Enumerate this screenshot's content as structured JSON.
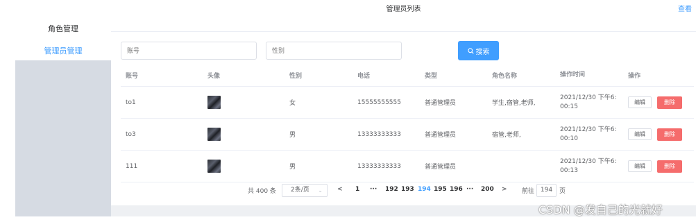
{
  "sidebar": {
    "items": [
      {
        "label": "角色管理"
      },
      {
        "label": "管理员管理"
      }
    ]
  },
  "header": {
    "title": "管理员列表",
    "view_link": "查看"
  },
  "search": {
    "account_placeholder": "账号",
    "gender_placeholder": "性别",
    "button_label": "搜索"
  },
  "table": {
    "columns": [
      "账号",
      "头像",
      "性别",
      "电话",
      "类型",
      "角色名称",
      "操作时间",
      "操作"
    ],
    "rows": [
      {
        "account": "to1",
        "gender": "女",
        "phone": "15555555555",
        "type": "普通管理员",
        "roles": "学生,宿管,老师,",
        "time": "2021/12/30 下午6:00:15",
        "time_line1": "2021/12/30 下午6:",
        "time_line2": "00:15"
      },
      {
        "account": "to3",
        "gender": "男",
        "phone": "13333333333",
        "type": "普通管理员",
        "roles": "宿管,老师,",
        "time": "2021/12/30 下午6:00:10",
        "time_line1": "2021/12/30 下午6:",
        "time_line2": "00:10"
      },
      {
        "account": "111",
        "gender": "男",
        "phone": "13333333333",
        "type": "普通管理员",
        "roles": "",
        "time": "2021/12/30 下午6:00:13",
        "time_line1": "2021/12/30 下午6:",
        "time_line2": "00:13"
      }
    ],
    "edit_label": "编辑",
    "delete_label": "删除"
  },
  "pagination": {
    "total": "共 400 条",
    "page_size": "2条/页",
    "prev": "<",
    "pages": [
      "1",
      "···",
      "192",
      "193",
      "194",
      "195",
      "196",
      "···",
      "200"
    ],
    "current": "194",
    "next": ">",
    "goto_label": "前往",
    "goto_value": "194",
    "page_suffix": "页"
  },
  "watermark": "CSDN @发自己的光就好",
  "colors": {
    "accent": "#409eff",
    "danger": "#f56c6c",
    "sidebar_bg": "#d6dbe3"
  }
}
